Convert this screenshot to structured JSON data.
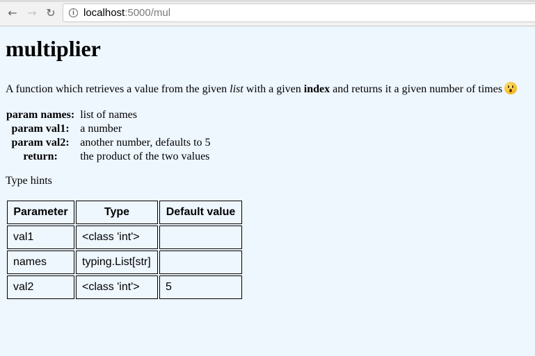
{
  "browser": {
    "url_host": "localhost",
    "url_rest": ":5000/mul",
    "back_icon": "arrow-left-icon",
    "forward_icon": "arrow-right-icon",
    "reload_icon": "reload-icon",
    "info_icon": "info-icon"
  },
  "page": {
    "title": "multiplier",
    "description": {
      "part1": "A function which retrieves a value from the given ",
      "list_word": "list",
      "part2": " with a given ",
      "index_word": "index",
      "part3": " and returns it a given number of times",
      "emoji": "hushed-face-emoji"
    },
    "params": [
      {
        "name": "param names:",
        "desc": "list of names"
      },
      {
        "name": "param val1:",
        "desc": "a number"
      },
      {
        "name": "param val2:",
        "desc": "another number, defaults to 5"
      },
      {
        "name": "return:",
        "desc": "the product of the two values"
      }
    ],
    "type_hints_label": "Type hints",
    "type_hints_table": {
      "headers": [
        "Parameter",
        "Type",
        "Default value"
      ],
      "rows": [
        [
          "val1",
          "<class 'int'>",
          ""
        ],
        [
          "names",
          "typing.List[str]",
          ""
        ],
        [
          "val2",
          "<class 'int'>",
          "5"
        ]
      ]
    }
  }
}
